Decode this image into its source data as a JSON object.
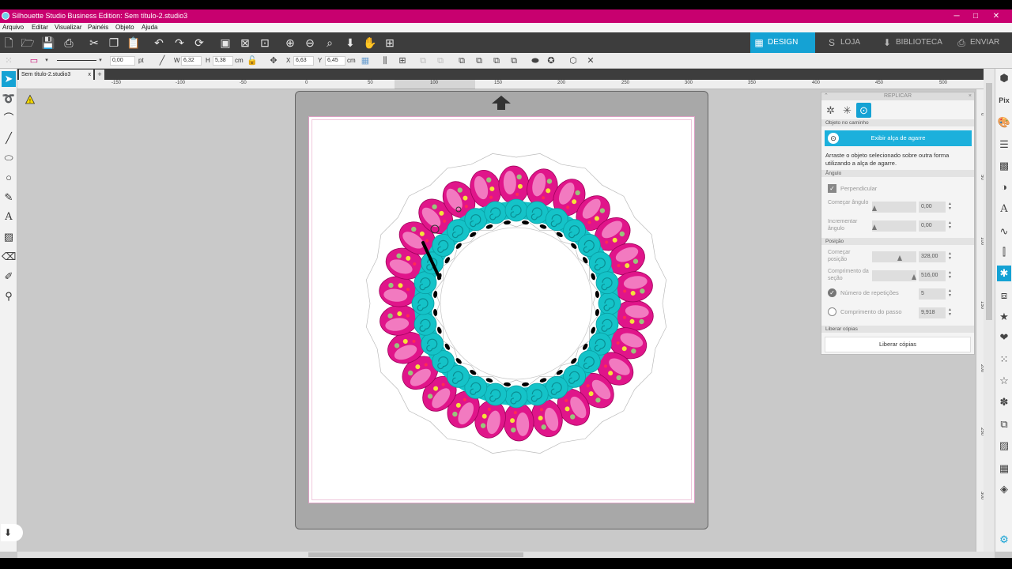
{
  "window": {
    "title": "Silhouette Studio Business Edition: Sem título-2.studio3",
    "controls": [
      "─",
      "□",
      "✕"
    ]
  },
  "menu": [
    "Arquivo",
    "Editar",
    "Visualizar",
    "Painéis",
    "Objeto",
    "Ajuda"
  ],
  "nav": {
    "design": "DESIGN",
    "store": "LOJA",
    "library": "BIBLIOTECA",
    "send": "ENVIAR",
    "accent": "#15a2d4"
  },
  "props": {
    "line_width": "0,00",
    "line_unit": "pt",
    "w_label": "W",
    "w_value": "6,32",
    "h_label": "H",
    "h_value": "5,38",
    "size_unit": "cm",
    "x_label": "X",
    "x_value": "6,63",
    "y_label": "Y",
    "y_value": "6,45",
    "pos_unit": "cm"
  },
  "document": {
    "tab_name": "Sem título-2.studio3",
    "close": "x",
    "add": "+"
  },
  "ruler": {
    "h_labels": [
      "-150",
      "-100",
      "-50",
      "0",
      "50",
      "100",
      "150",
      "200",
      "250",
      "300",
      "350",
      "400",
      "450",
      "500"
    ],
    "v_labels": [
      "0",
      "50",
      "100",
      "150",
      "200",
      "250",
      "300"
    ]
  },
  "panel": {
    "title": "REPLICAR",
    "tab_icons": [
      "replicate-icon",
      "replicate-offset-icon",
      "path-replicate-icon"
    ],
    "section_object": "Objeto no caminho",
    "grab_button": "Exibir alça de agarre",
    "description": "Arraste o objeto selecionado sobre outra forma utilizando a alça de agarre.",
    "section_angle": "Ângulo",
    "perpendicular": "Perpendicular",
    "start_angle_label": "Começar ângulo",
    "start_angle_value": "0,00",
    "increment_angle_label": "Incrementar ângulo",
    "increment_angle_value": "0,00",
    "section_position": "Posição",
    "start_position_label": "Começar posição",
    "start_position_value": "328,00",
    "section_length_label": "Comprimento da seção",
    "section_length_value": "516,00",
    "repeat_count_label": "Número de repetições",
    "repeat_count_value": "5",
    "step_length_label": "Comprimento do passo",
    "step_length_value": "9,918",
    "section_release": "Liberar cópias",
    "release_button": "Liberar cópias"
  },
  "artwork": {
    "leaf_color": "#e0158a",
    "leaf_light": "#f27ac0",
    "swirl_color": "#14c3c8",
    "dot_yellow": "#f5e23a",
    "dot_green": "#9ac47c",
    "dot_red": "#ff2a55"
  }
}
